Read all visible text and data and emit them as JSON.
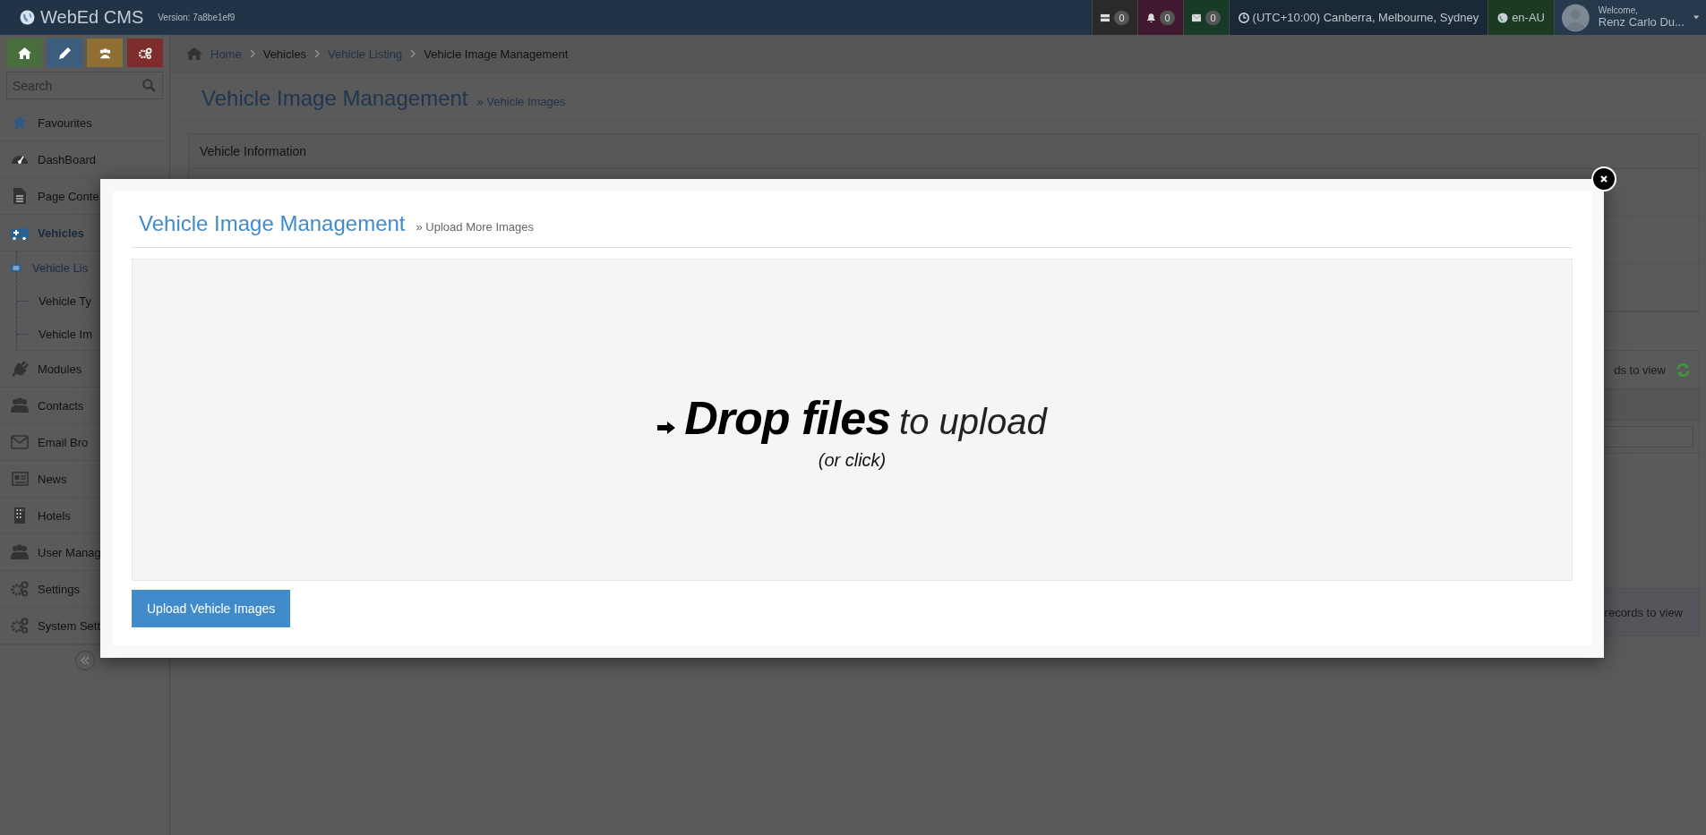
{
  "topbar": {
    "logo": "WebEd CMS",
    "version": "Version: 7a8be1ef9",
    "badges": [
      {
        "count": "0",
        "color": "#2a2a2a"
      },
      {
        "count": "0",
        "color": "#40182f"
      },
      {
        "count": "0",
        "color": "#183a26"
      }
    ],
    "timezone": "(UTC+10:00) Canberra, Melbourne, Sydney",
    "locale": "en-AU",
    "welcome": "Welcome,",
    "user": "Renz Carlo Du..."
  },
  "sidebar": {
    "quick_buttons": [
      {
        "color": "#486e3e"
      },
      {
        "color": "#3c5d7c"
      },
      {
        "color": "#8f6f33"
      },
      {
        "color": "#7d2d2b"
      }
    ],
    "search": {
      "placeholder": "Search"
    },
    "items": [
      {
        "label": "Favourites",
        "selected": false
      },
      {
        "label": "DashBoard",
        "selected": false
      },
      {
        "label": "Page Conte",
        "selected": false
      },
      {
        "label": "Vehicles",
        "selected": true,
        "children": [
          {
            "label": "Vehicle Lis",
            "selected": true
          },
          {
            "label": "Vehicle Ty",
            "selected": false
          },
          {
            "label": "Vehicle Im",
            "selected": false
          }
        ]
      },
      {
        "label": "Modules",
        "selected": false
      },
      {
        "label": "Contacts",
        "selected": false
      },
      {
        "label": "Email Bro",
        "selected": false
      },
      {
        "label": "News",
        "selected": false
      },
      {
        "label": "Hotels",
        "selected": false
      },
      {
        "label": "User Manag",
        "selected": false
      },
      {
        "label": "Settings",
        "selected": false
      },
      {
        "label": "System Sett",
        "selected": false
      }
    ]
  },
  "breadcrumb": [
    {
      "label": "Home",
      "link": true
    },
    {
      "label": "Vehicles",
      "link": false
    },
    {
      "label": "Vehicle Listing",
      "link": true
    },
    {
      "label": "Vehicle Image Management",
      "link": false
    }
  ],
  "page": {
    "title": "Vehicle Image Management",
    "subtitle": "» Vehicle Images",
    "info_panel": "Vehicle Information",
    "listing_header": "ds to view",
    "listing_footer": "records to view"
  },
  "modal": {
    "title": "Vehicle Image Management",
    "subtitle": "» Upload More Images",
    "dropzone": {
      "strong": "Drop files",
      "rest": "to upload",
      "hint": "(or click)"
    },
    "button": "Upload Vehicle Images"
  }
}
